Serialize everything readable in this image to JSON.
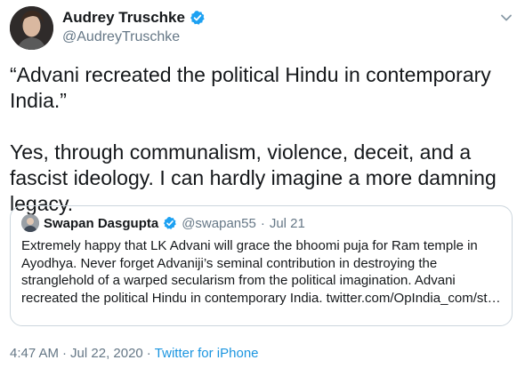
{
  "tweet": {
    "author": {
      "name": "Audrey Truschke",
      "handle": "@AudreyTruschke"
    },
    "text": "“Advani recreated the political Hindu in contemporary India.”\n\nYes, through communalism, violence, deceit, and a fascist ideology. I can hardly imagine a more damning legacy.",
    "quoted": {
      "name": "Swapan Dasgupta",
      "handle": "@swapan55",
      "separator": "·",
      "date": "Jul 21",
      "text": "Extremely happy that LK Advani will grace the bhoomi puja for Ram temple in Ayodhya. Never forget Advaniji’s seminal contribution in destroying the stranglehold of a warped secularism from the political imagination. Advani recreated the political Hindu in contemporary India. twitter.com/OpIndia_com/st…"
    },
    "time": "4:47 AM",
    "separator1": "·",
    "date": "Jul 22, 2020",
    "separator2": "·",
    "source": "Twitter for iPhone"
  },
  "colors": {
    "verified": "#1da1f2",
    "link": "#1b95e0",
    "muted": "#657786",
    "border": "#ccd6dd"
  },
  "icons": {
    "verified": "verified-badge-icon",
    "more": "chevron-down-icon"
  }
}
